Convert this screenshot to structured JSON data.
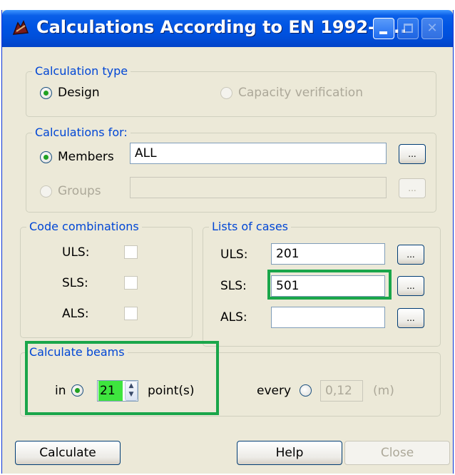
{
  "window": {
    "title": "Calculations According to EN 1992-1..."
  },
  "calc_type": {
    "legend": "Calculation type",
    "design_label": "Design",
    "capacity_label": "Capacity verification",
    "selected": "Design"
  },
  "calc_for": {
    "legend": "Calculations for:",
    "members_label": "Members",
    "members_value": "ALL",
    "groups_label": "Groups",
    "groups_value": "",
    "browse_label": "..."
  },
  "code_combinations": {
    "legend": "Code combinations",
    "uls_label": "ULS:",
    "sls_label": "SLS:",
    "als_label": "ALS:"
  },
  "lists_of_cases": {
    "legend": "Lists of cases",
    "uls_label": "ULS:",
    "uls_value": "201",
    "sls_label": "SLS:",
    "sls_value": "501",
    "als_label": "ALS:",
    "als_value": "",
    "browse_label": "..."
  },
  "calculate_beams": {
    "legend": "Calculate beams",
    "in_label": "in",
    "points_value": "21",
    "points_unit": "point(s)",
    "every_label": "every",
    "every_value": "0,12",
    "every_unit": "(m)"
  },
  "buttons": {
    "calculate": "Calculate",
    "help": "Help",
    "close": "Close"
  },
  "colors": {
    "highlight": "#1aa64a",
    "spin_value_bg": "#3ee43e"
  }
}
